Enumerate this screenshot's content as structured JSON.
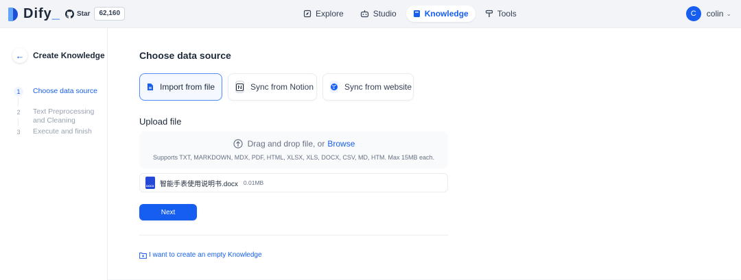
{
  "app": {
    "name": "Dify",
    "name_suffix": "_"
  },
  "github": {
    "star_label": "Star",
    "star_count": "62,160"
  },
  "nav": {
    "items": [
      {
        "label": "Explore",
        "icon": "compass-icon",
        "active": false
      },
      {
        "label": "Studio",
        "icon": "robot-icon",
        "active": false
      },
      {
        "label": "Knowledge",
        "icon": "book-icon",
        "active": true
      },
      {
        "label": "Tools",
        "icon": "hammer-icon",
        "active": false
      }
    ]
  },
  "user": {
    "initial": "C",
    "name": "colin"
  },
  "sidebar": {
    "title": "Create Knowledge",
    "steps": [
      {
        "num": "1",
        "label": "Choose data source",
        "active": true
      },
      {
        "num": "2",
        "label": "Text Preprocessing and Cleaning",
        "active": false
      },
      {
        "num": "3",
        "label": "Execute and finish",
        "active": false
      }
    ]
  },
  "main": {
    "title": "Choose data source",
    "sources": [
      {
        "label": "Import from file",
        "icon": "file-icon",
        "active": true
      },
      {
        "label": "Sync from Notion",
        "icon": "notion-icon",
        "active": false
      },
      {
        "label": "Sync from website",
        "icon": "globe-icon",
        "active": false
      }
    ],
    "upload_title": "Upload file",
    "dropzone": {
      "text": "Drag and drop file, or",
      "browse": "Browse",
      "hint": "Supports TXT, MARKDOWN, MDX, PDF, HTML, XLSX, XLS, DOCX, CSV, MD, HTM. Max 15MB each."
    },
    "file": {
      "badge": "DOCX",
      "name": "智能手表使用说明书.docx",
      "size": "0.01MB"
    },
    "next_label": "Next",
    "empty_link": "I want to create an empty Knowledge"
  },
  "colors": {
    "accent": "#155eef",
    "bg": "#f2f4f7",
    "border": "#eaecf0"
  }
}
